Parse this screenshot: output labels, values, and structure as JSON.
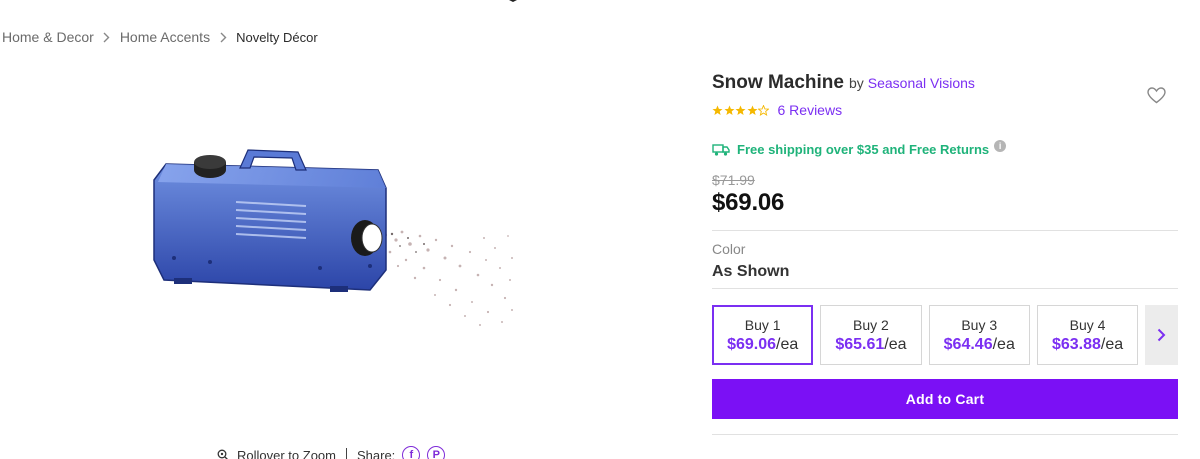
{
  "breadcrumb": {
    "items": [
      "Home & Decor",
      "Home Accents"
    ],
    "current": "Novelty Décor"
  },
  "product": {
    "title": "Snow Machine",
    "by": "by",
    "brand": "Seasonal Visions",
    "rating": 4,
    "rating_max": 5,
    "reviews": "6 Reviews",
    "shipping": "Free shipping over $35 and Free Returns",
    "original_price": "$71.99",
    "price": "$69.06",
    "color_label": "Color",
    "color_value": "As Shown"
  },
  "quantity_options": [
    {
      "label": "Buy 1",
      "price": "$69.06",
      "unit": "/ea",
      "selected": true
    },
    {
      "label": "Buy 2",
      "price": "$65.61",
      "unit": "/ea",
      "selected": false
    },
    {
      "label": "Buy 3",
      "price": "$64.46",
      "unit": "/ea",
      "selected": false
    },
    {
      "label": "Buy 4",
      "price": "$63.88",
      "unit": "/ea",
      "selected": false
    }
  ],
  "actions": {
    "add_to_cart": "Add to Cart"
  },
  "gallery": {
    "zoom_hint": "Rollover to Zoom",
    "share_label": "Share:"
  },
  "icons": {
    "heart": "heart-icon",
    "truck": "truck-icon",
    "info": "info-icon",
    "star": "star-icon",
    "chevron": "chevron-right-icon",
    "zoom": "zoom-icon",
    "facebook": "facebook-icon",
    "pinterest": "pinterest-icon"
  },
  "colors": {
    "accent": "#7b2ff2",
    "cta": "#7b10f5",
    "shipping": "#1fb37a",
    "star": "#f5b800"
  }
}
